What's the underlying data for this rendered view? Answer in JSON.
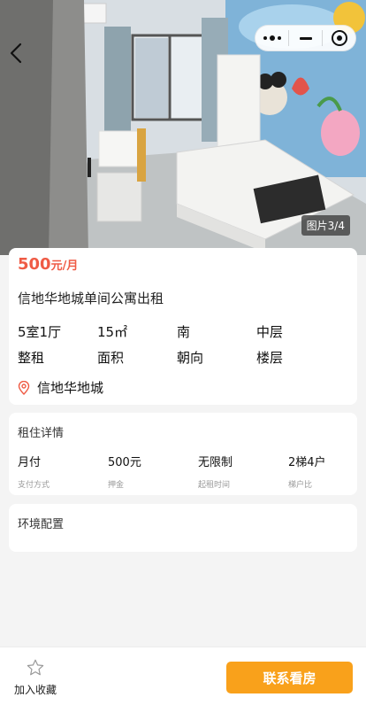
{
  "gallery": {
    "counter": "图片3/4"
  },
  "listing": {
    "price_amount": "500",
    "price_unit": "元/月",
    "title": "信地华地城单间公寓出租",
    "specs": [
      {
        "value": "5室1厅",
        "label": "整租"
      },
      {
        "value": "15㎡",
        "label": "面积"
      },
      {
        "value": "南",
        "label": "朝向"
      },
      {
        "value": "中层",
        "label": "楼层"
      }
    ],
    "location": "信地华地城"
  },
  "rent_details": {
    "title": "租住详情",
    "items": [
      {
        "value": "月付",
        "label": "支付方式"
      },
      {
        "value": "500元",
        "label": "押金"
      },
      {
        "value": "无限制",
        "label": "起租时间"
      },
      {
        "value": "2梯4户",
        "label": "梯户比"
      }
    ]
  },
  "environment": {
    "title": "环境配置"
  },
  "bottom_bar": {
    "favorite_label": "加入收藏",
    "contact_label": "联系看房"
  },
  "colors": {
    "price": "#ef5b45",
    "cta": "#f9a11b",
    "location_icon": "#ef5b45"
  },
  "icons": {
    "back": "chevron-left-icon",
    "more": "more-dots-icon",
    "minimize": "minimize-icon",
    "close": "target-close-icon",
    "location": "location-pin-icon",
    "favorite": "star-outline-icon"
  }
}
